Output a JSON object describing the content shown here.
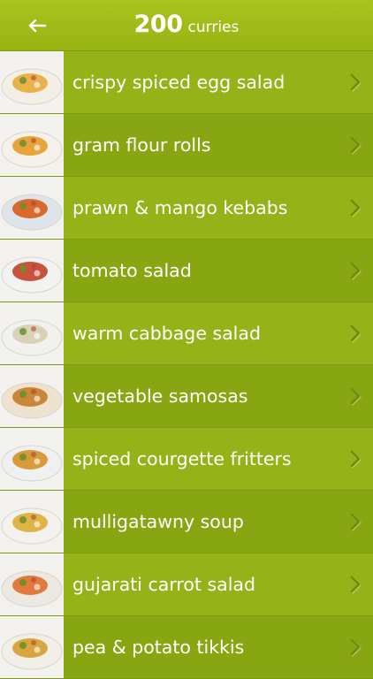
{
  "header": {
    "title_number": "200",
    "title_word": "curries",
    "back_icon": "back-arrow-icon"
  },
  "recipes": [
    {
      "label": "crispy spiced egg salad",
      "thumb": "#e9b24a",
      "plate": "#f4efe6"
    },
    {
      "label": "gram flour rolls",
      "thumb": "#e7a43a",
      "plate": "#f5f2ec"
    },
    {
      "label": "prawn & mango kebabs",
      "thumb": "#d9692e",
      "plate": "#dfe4ea"
    },
    {
      "label": "tomato salad",
      "thumb": "#c9523d",
      "plate": "#f3f3f1"
    },
    {
      "label": "warm cabbage salad",
      "thumb": "#d9d2b6",
      "plate": "#f1f1ee"
    },
    {
      "label": "vegetable samosas",
      "thumb": "#c98738",
      "plate": "#efe3cf"
    },
    {
      "label": "spiced courgette fritters",
      "thumb": "#d99a3a",
      "plate": "#eef0f2"
    },
    {
      "label": "mulligatawny soup",
      "thumb": "#e0b347",
      "plate": "#f3f2ee"
    },
    {
      "label": "gujarati carrot salad",
      "thumb": "#e07a3e",
      "plate": "#ece9e3"
    },
    {
      "label": "pea & potato tikkis",
      "thumb": "#d8a63f",
      "plate": "#f2efe8"
    }
  ],
  "colors": {
    "header": "#a9c21e",
    "row_odd": "#95b219",
    "row_even": "#88a512",
    "text": "#ffffff",
    "chevron": "#6f8a10"
  }
}
